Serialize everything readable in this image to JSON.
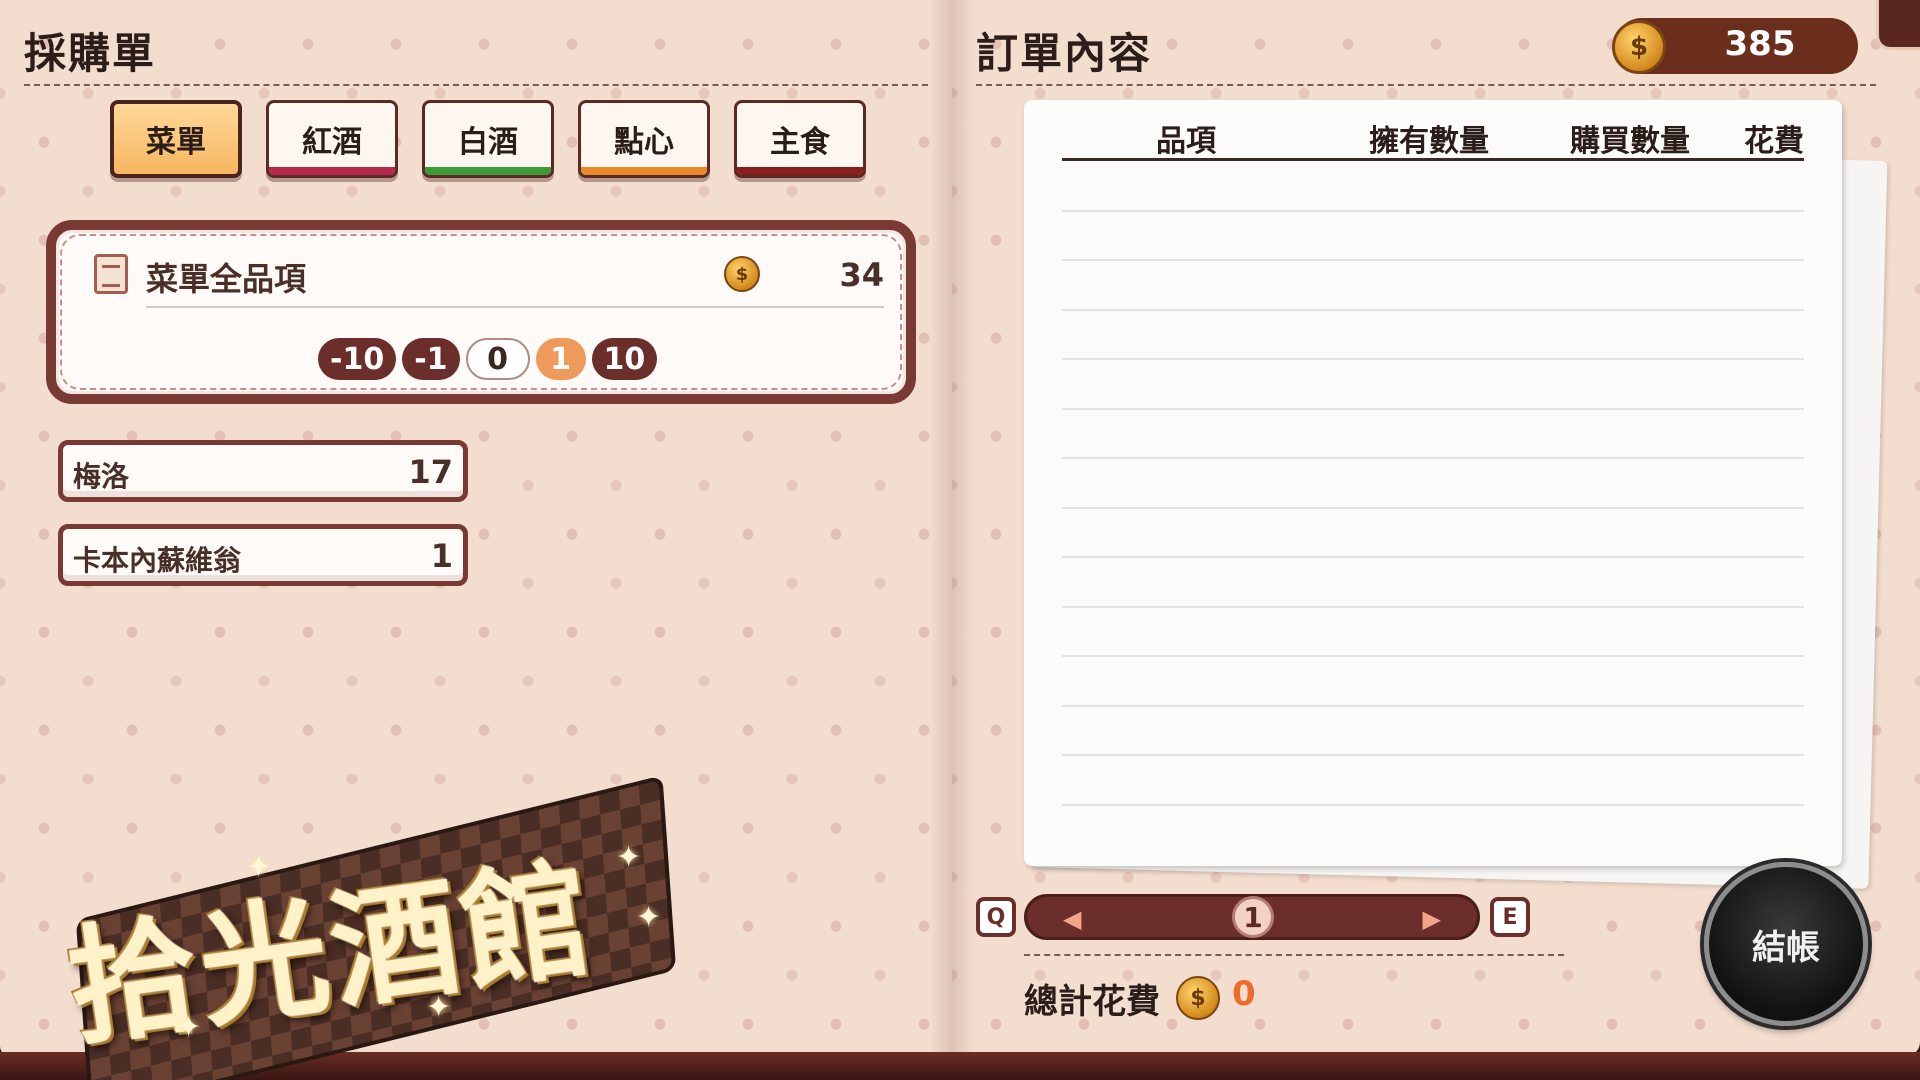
{
  "left": {
    "title": "採購單",
    "tabs": [
      {
        "label": "菜單",
        "active": true,
        "stripe": "#f6b660"
      },
      {
        "label": "紅酒",
        "active": false,
        "stripe": "#b4284a"
      },
      {
        "label": "白酒",
        "active": false,
        "stripe": "#3b9a3a"
      },
      {
        "label": "點心",
        "active": false,
        "stripe": "#e8892a"
      },
      {
        "label": "主食",
        "active": false,
        "stripe": "#8a1e1a"
      }
    ],
    "menu_card": {
      "title": "菜單全品項",
      "price": "34",
      "quantities": [
        "-10",
        "-1",
        "0",
        "1",
        "10"
      ]
    },
    "items": [
      {
        "name": "梅洛",
        "value": "17"
      },
      {
        "name": "卡本內蘇維翁",
        "value": "1"
      }
    ],
    "logo_text": "拾光酒館"
  },
  "right": {
    "title": "訂單內容",
    "coins": "385",
    "table_headers": [
      "品項",
      "擁有數量",
      "購買數量",
      "花費"
    ],
    "pager": {
      "prev_key": "Q",
      "next_key": "E",
      "page": "1"
    },
    "total_label": "總計花費",
    "total_value": "0",
    "checkout_label": "結帳"
  },
  "icons": {
    "coin": "coin-icon",
    "menu_book": "menu-book-icon",
    "arrow_left": "arrow-left-icon",
    "arrow_right": "arrow-right-icon"
  },
  "colors": {
    "page_bg": "#f3ddcf",
    "accent_maroon": "#6b2e2a",
    "active_tab": "#f6b660",
    "total_value": "#f06a2a"
  }
}
